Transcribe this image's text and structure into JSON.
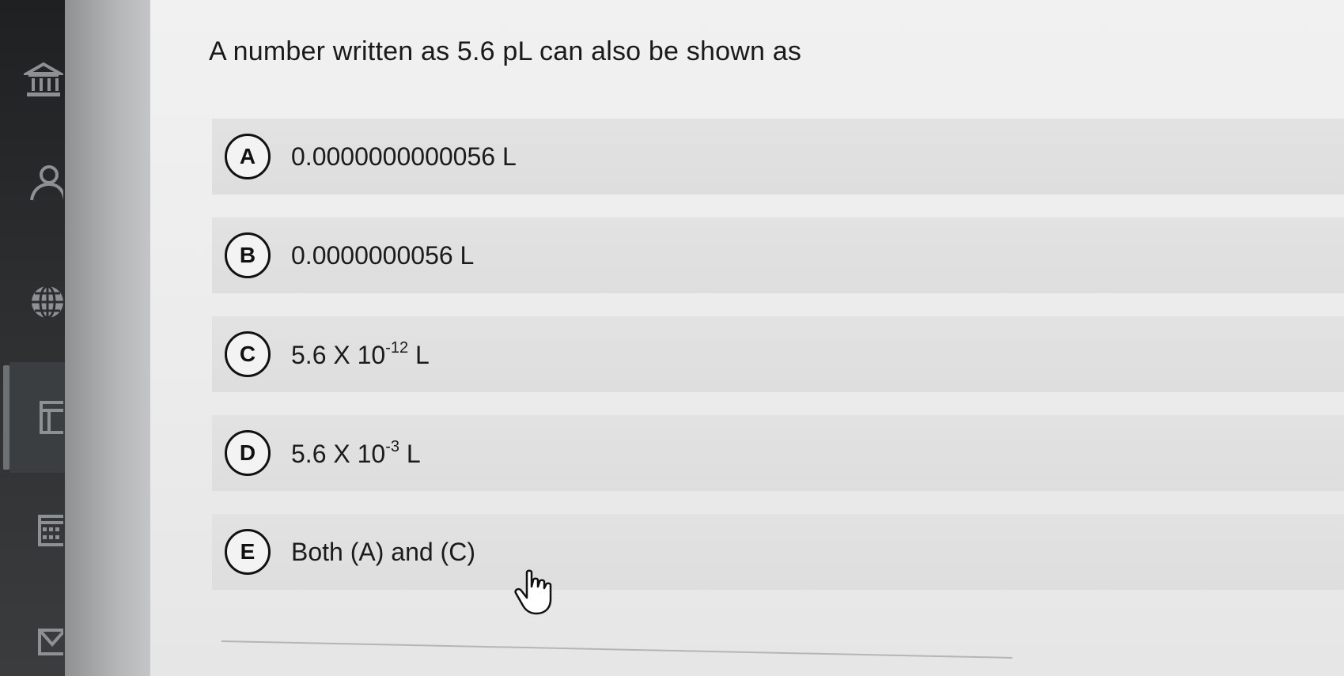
{
  "question": {
    "text": "A number written as 5.6 pL can also be shown as"
  },
  "options": [
    {
      "letter": "A",
      "text": "0.0000000000056 L"
    },
    {
      "letter": "B",
      "text": "0.0000000056 L"
    },
    {
      "letter": "C",
      "base": "5.6 X 10",
      "exponent": "-12",
      "unit": " L"
    },
    {
      "letter": "D",
      "base": "5.6 X 10",
      "exponent": "-3",
      "unit": " L"
    },
    {
      "letter": "E",
      "text": "Both (A) and (C)"
    }
  ],
  "rail_icons": [
    "institution-icon",
    "user-icon",
    "globe-icon",
    "gradebook-icon",
    "calendar-icon",
    "inbox-icon"
  ]
}
